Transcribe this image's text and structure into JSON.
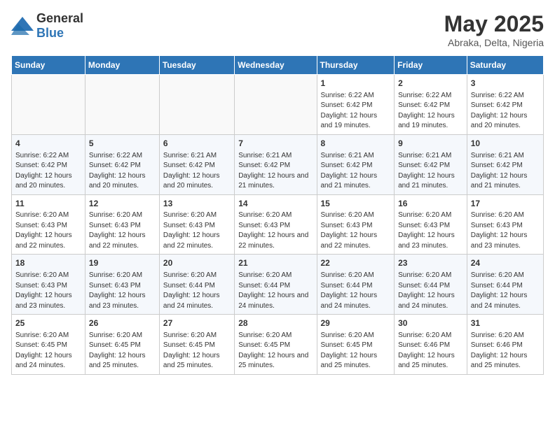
{
  "logo": {
    "general": "General",
    "blue": "Blue"
  },
  "title": "May 2025",
  "subtitle": "Abraka, Delta, Nigeria",
  "days_of_week": [
    "Sunday",
    "Monday",
    "Tuesday",
    "Wednesday",
    "Thursday",
    "Friday",
    "Saturday"
  ],
  "weeks": [
    [
      {
        "day": "",
        "info": ""
      },
      {
        "day": "",
        "info": ""
      },
      {
        "day": "",
        "info": ""
      },
      {
        "day": "",
        "info": ""
      },
      {
        "day": "1",
        "info": "Sunrise: 6:22 AM\nSunset: 6:42 PM\nDaylight: 12 hours and 19 minutes."
      },
      {
        "day": "2",
        "info": "Sunrise: 6:22 AM\nSunset: 6:42 PM\nDaylight: 12 hours and 19 minutes."
      },
      {
        "day": "3",
        "info": "Sunrise: 6:22 AM\nSunset: 6:42 PM\nDaylight: 12 hours and 20 minutes."
      }
    ],
    [
      {
        "day": "4",
        "info": "Sunrise: 6:22 AM\nSunset: 6:42 PM\nDaylight: 12 hours and 20 minutes."
      },
      {
        "day": "5",
        "info": "Sunrise: 6:22 AM\nSunset: 6:42 PM\nDaylight: 12 hours and 20 minutes."
      },
      {
        "day": "6",
        "info": "Sunrise: 6:21 AM\nSunset: 6:42 PM\nDaylight: 12 hours and 20 minutes."
      },
      {
        "day": "7",
        "info": "Sunrise: 6:21 AM\nSunset: 6:42 PM\nDaylight: 12 hours and 21 minutes."
      },
      {
        "day": "8",
        "info": "Sunrise: 6:21 AM\nSunset: 6:42 PM\nDaylight: 12 hours and 21 minutes."
      },
      {
        "day": "9",
        "info": "Sunrise: 6:21 AM\nSunset: 6:42 PM\nDaylight: 12 hours and 21 minutes."
      },
      {
        "day": "10",
        "info": "Sunrise: 6:21 AM\nSunset: 6:42 PM\nDaylight: 12 hours and 21 minutes."
      }
    ],
    [
      {
        "day": "11",
        "info": "Sunrise: 6:20 AM\nSunset: 6:43 PM\nDaylight: 12 hours and 22 minutes."
      },
      {
        "day": "12",
        "info": "Sunrise: 6:20 AM\nSunset: 6:43 PM\nDaylight: 12 hours and 22 minutes."
      },
      {
        "day": "13",
        "info": "Sunrise: 6:20 AM\nSunset: 6:43 PM\nDaylight: 12 hours and 22 minutes."
      },
      {
        "day": "14",
        "info": "Sunrise: 6:20 AM\nSunset: 6:43 PM\nDaylight: 12 hours and 22 minutes."
      },
      {
        "day": "15",
        "info": "Sunrise: 6:20 AM\nSunset: 6:43 PM\nDaylight: 12 hours and 22 minutes."
      },
      {
        "day": "16",
        "info": "Sunrise: 6:20 AM\nSunset: 6:43 PM\nDaylight: 12 hours and 23 minutes."
      },
      {
        "day": "17",
        "info": "Sunrise: 6:20 AM\nSunset: 6:43 PM\nDaylight: 12 hours and 23 minutes."
      }
    ],
    [
      {
        "day": "18",
        "info": "Sunrise: 6:20 AM\nSunset: 6:43 PM\nDaylight: 12 hours and 23 minutes."
      },
      {
        "day": "19",
        "info": "Sunrise: 6:20 AM\nSunset: 6:43 PM\nDaylight: 12 hours and 23 minutes."
      },
      {
        "day": "20",
        "info": "Sunrise: 6:20 AM\nSunset: 6:44 PM\nDaylight: 12 hours and 24 minutes."
      },
      {
        "day": "21",
        "info": "Sunrise: 6:20 AM\nSunset: 6:44 PM\nDaylight: 12 hours and 24 minutes."
      },
      {
        "day": "22",
        "info": "Sunrise: 6:20 AM\nSunset: 6:44 PM\nDaylight: 12 hours and 24 minutes."
      },
      {
        "day": "23",
        "info": "Sunrise: 6:20 AM\nSunset: 6:44 PM\nDaylight: 12 hours and 24 minutes."
      },
      {
        "day": "24",
        "info": "Sunrise: 6:20 AM\nSunset: 6:44 PM\nDaylight: 12 hours and 24 minutes."
      }
    ],
    [
      {
        "day": "25",
        "info": "Sunrise: 6:20 AM\nSunset: 6:45 PM\nDaylight: 12 hours and 24 minutes."
      },
      {
        "day": "26",
        "info": "Sunrise: 6:20 AM\nSunset: 6:45 PM\nDaylight: 12 hours and 25 minutes."
      },
      {
        "day": "27",
        "info": "Sunrise: 6:20 AM\nSunset: 6:45 PM\nDaylight: 12 hours and 25 minutes."
      },
      {
        "day": "28",
        "info": "Sunrise: 6:20 AM\nSunset: 6:45 PM\nDaylight: 12 hours and 25 minutes."
      },
      {
        "day": "29",
        "info": "Sunrise: 6:20 AM\nSunset: 6:45 PM\nDaylight: 12 hours and 25 minutes."
      },
      {
        "day": "30",
        "info": "Sunrise: 6:20 AM\nSunset: 6:46 PM\nDaylight: 12 hours and 25 minutes."
      },
      {
        "day": "31",
        "info": "Sunrise: 6:20 AM\nSunset: 6:46 PM\nDaylight: 12 hours and 25 minutes."
      }
    ]
  ]
}
